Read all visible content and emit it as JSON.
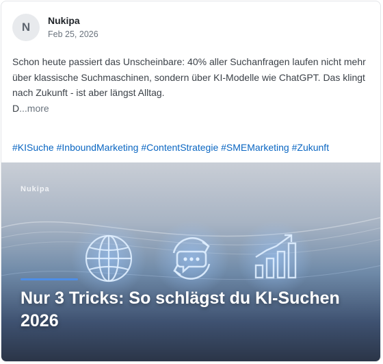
{
  "post": {
    "avatar_initial": "N",
    "author": "Nukipa",
    "date": "Feb 25, 2026",
    "body_line_1": "Schon heute passiert das Unscheinbare: 40% aller Suchanfragen laufen nicht mehr über klassische Suchmaschinen, sondern über KI-Modelle wie ChatGPT. Das klingt nach Zukunft - ist aber längst Alltag.",
    "truncated_text": "D",
    "more_label": "...more",
    "hashtags": [
      "#KISuche",
      "#InboundMarketing",
      "#ContentStrategie",
      "#SMEMarketing",
      "#Zukunft"
    ]
  },
  "image": {
    "brand": "Nukipa",
    "headline": "Nur 3 Tricks: So schlägst du KI-Suchen 2026",
    "icons": [
      "globe-icon",
      "chat-refresh-icon",
      "growth-chart-icon"
    ],
    "accent_color": "#4d8ee8"
  }
}
